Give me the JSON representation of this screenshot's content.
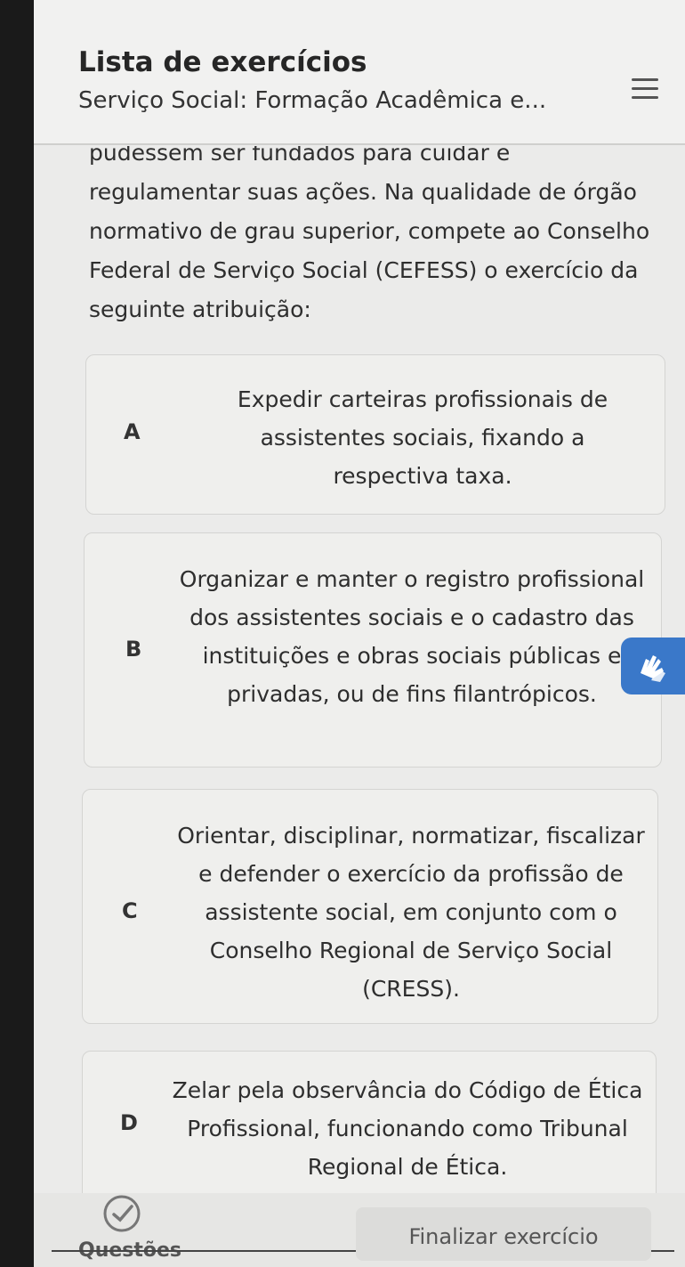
{
  "header": {
    "title": "Lista de exercícios",
    "subtitle": "Serviço Social: Formação Acadêmica e...",
    "menu_icon": "hamburger-menu-icon"
  },
  "question": {
    "text": "pudessem ser fundados para cuidar e regulamentar suas ações. Na qualidade de órgão normativo de grau superior, compete ao Conselho Federal de Serviço Social (CEFESS) o exercício da seguinte atribuição:"
  },
  "options": [
    {
      "letter": "A",
      "text": "Expedir carteiras profissionais de assistentes sociais, fixando a respectiva taxa."
    },
    {
      "letter": "B",
      "text": "Organizar e manter o registro profissional dos assistentes sociais e o cadastro das instituições e obras sociais públicas e privadas, ou de fins filantrópicos."
    },
    {
      "letter": "C",
      "text": "Orientar, disciplinar, normatizar, fiscalizar e defender o exercício da profissão de assistente social, em conjunto com o Conselho Regional de Serviço Social (CRESS)."
    },
    {
      "letter": "D",
      "text": "Zelar pela observância do Código de Ética Profissional, funcionando como Tribunal Regional de Ética."
    }
  ],
  "libras_button_icon": "sign-language-hands-icon",
  "footer": {
    "questions_label": "Questões",
    "finish_label": "Finalizar exercício",
    "check_icon": "check-circle-icon"
  },
  "colors": {
    "accent_blue": "#3a78c9",
    "background": "#ebebea"
  }
}
